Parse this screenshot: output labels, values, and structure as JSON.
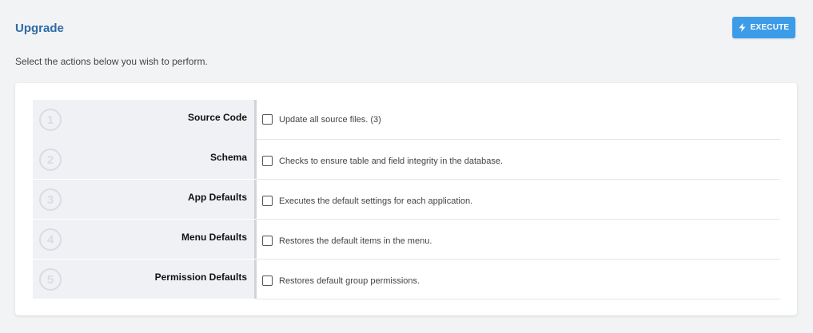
{
  "header": {
    "title": "Upgrade",
    "execute_label": "EXECUTE"
  },
  "subtitle": "Select the actions below you wish to perform.",
  "actions": [
    {
      "number": "1",
      "label": "Source Code",
      "description": "Update all source files. (3)"
    },
    {
      "number": "2",
      "label": "Schema",
      "description": "Checks to ensure table and field integrity in the database."
    },
    {
      "number": "3",
      "label": "App Defaults",
      "description": "Executes the default settings for each application."
    },
    {
      "number": "4",
      "label": "Menu Defaults",
      "description": "Restores the default items in the menu."
    },
    {
      "number": "5",
      "label": "Permission Defaults",
      "description": "Restores default group permissions."
    }
  ],
  "colors": {
    "accent": "#3d9ce8",
    "title": "#2e6aa6",
    "background": "#f2f3f5"
  },
  "icons": {
    "execute": "lightning-bolt-icon"
  }
}
